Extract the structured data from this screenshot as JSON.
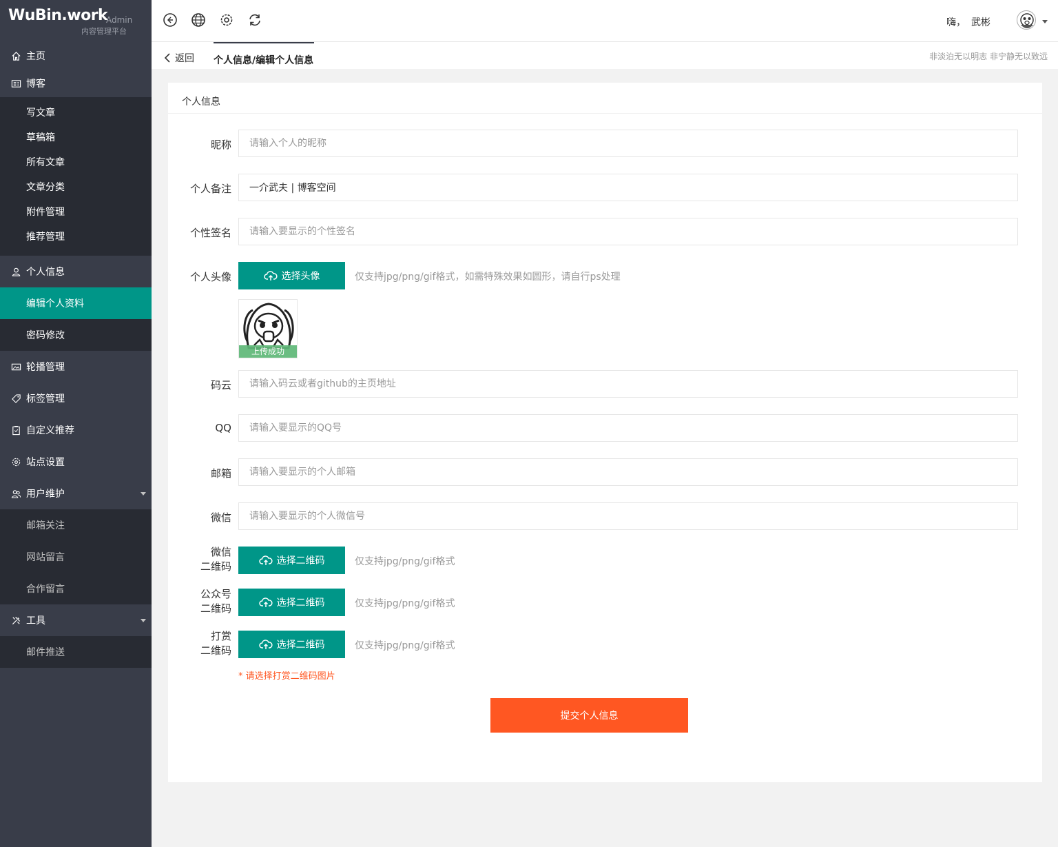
{
  "brand": {
    "title": "WuBin.work",
    "badge": "Admin",
    "subtitle": "内容管理平台"
  },
  "sidebar": {
    "home": "主页",
    "blog": {
      "label": "博客",
      "items": [
        "写文章",
        "草稿箱",
        "所有文章",
        "文章分类",
        "附件管理",
        "推荐管理"
      ]
    },
    "profile": {
      "label": "个人信息",
      "items": [
        "编辑个人资料",
        "密码修改"
      ],
      "active": "编辑个人资料"
    },
    "carousel": "轮播管理",
    "tags": "标签管理",
    "custom": "自定义推荐",
    "site": "站点设置",
    "users": {
      "label": "用户维护",
      "items": [
        "邮箱关注",
        "网站留言",
        "合作留言"
      ]
    },
    "tools": {
      "label": "工具",
      "items": [
        "邮件推送"
      ]
    }
  },
  "header": {
    "icons": [
      "back-arrow-icon",
      "globe-icon",
      "gear-icon",
      "refresh-icon"
    ],
    "greeting": "嗨，",
    "username": "武彬"
  },
  "breadcrumb": {
    "back": "返回",
    "title": "个人信息/编辑个人信息",
    "motto": "非淡泊无以明志 非宁静无以致远"
  },
  "card": {
    "title": "个人信息",
    "fields": {
      "nickname": {
        "label": "昵称",
        "value": "",
        "placeholder": "请输入个人的昵称"
      },
      "remark": {
        "label": "个人备注",
        "value": "一介武夫 | 博客空间",
        "placeholder": ""
      },
      "signature": {
        "label": "个性签名",
        "value": "",
        "placeholder": "请输入要显示的个性签名"
      },
      "avatar": {
        "label": "个人头像",
        "button": "选择头像",
        "hint": "仅支持jpg/png/gif格式，如需特殊效果如圆形，请自行ps处理",
        "status": "上传成功"
      },
      "gitee": {
        "label": "码云",
        "value": "",
        "placeholder": "请输入码云或者github的主页地址"
      },
      "qq": {
        "label": "QQ",
        "value": "",
        "placeholder": "请输入要显示的QQ号"
      },
      "email": {
        "label": "邮箱",
        "value": "",
        "placeholder": "请输入要显示的个人邮箱"
      },
      "wechat": {
        "label": "微信",
        "value": "",
        "placeholder": "请输入要显示的个人微信号"
      },
      "wechat_qr": {
        "label_1": "微信",
        "label_2": "二维码",
        "button": "选择二维码",
        "hint": "仅支持jpg/png/gif格式"
      },
      "mp_qr": {
        "label_1": "公众号",
        "label_2": "二维码",
        "button": "选择二维码",
        "hint": "仅支持jpg/png/gif格式"
      },
      "reward_qr": {
        "label_1": "打赏",
        "label_2": "二维码",
        "button": "选择二维码",
        "hint": "仅支持jpg/png/gif格式"
      }
    },
    "error": "* 请选择打赏二维码图片",
    "submit": "提交个人信息"
  },
  "colors": {
    "sidebar": "#393d49",
    "submenu": "#282b33",
    "accent": "#009688",
    "submit": "#ff5722",
    "success": "#5fb878"
  }
}
